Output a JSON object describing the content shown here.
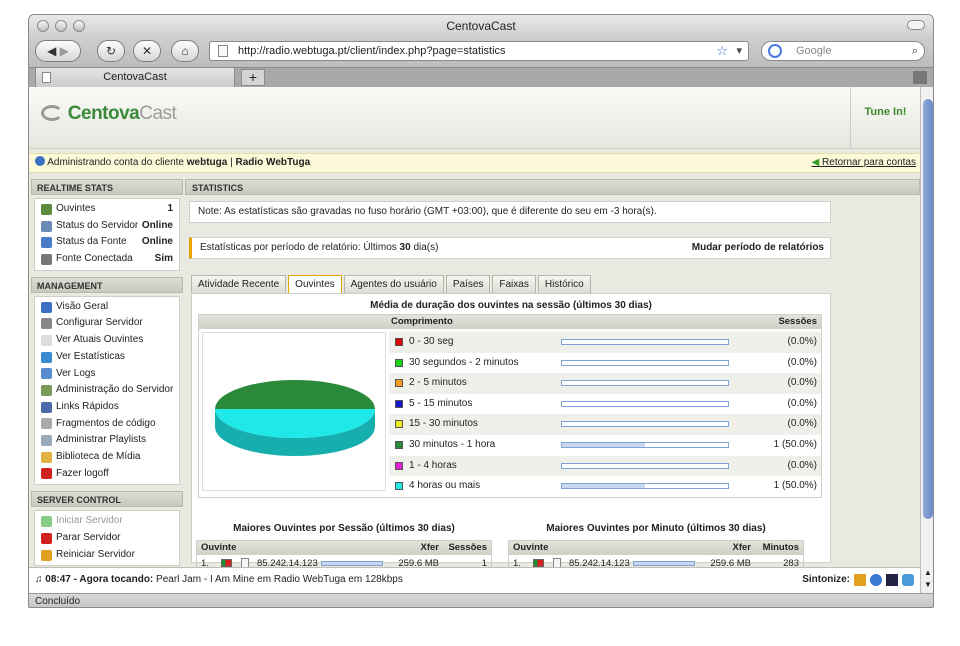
{
  "window": {
    "title": "CentovaCast"
  },
  "browser": {
    "url": "http://radio.webtuga.pt/client/index.php?page=statistics",
    "search_placeholder": "Google",
    "tab_title": "CentovaCast",
    "status": "Concluído"
  },
  "header": {
    "logo_main": "Centova",
    "logo_sub": "Cast",
    "tunein": "Tune In!"
  },
  "infobar": {
    "prefix": "Administrando conta do cliente",
    "client": "webtuga",
    "separator": "|",
    "station": "Radio WebTuga",
    "return_link": "Retornar para contas"
  },
  "sidebar": {
    "realtime": {
      "title": "REALTIME STATS",
      "items": [
        {
          "label": "Ouvintes",
          "value": "1",
          "icon": "listeners-icon"
        },
        {
          "label": "Status do Servidor",
          "value": "Online",
          "icon": "server-status-icon"
        },
        {
          "label": "Status da Fonte",
          "value": "Online",
          "icon": "source-status-icon"
        },
        {
          "label": "Fonte Conectada",
          "value": "Sim",
          "icon": "speaker-icon"
        }
      ]
    },
    "management": {
      "title": "MANAGEMENT",
      "items": [
        {
          "label": "Visão Geral",
          "icon": "info-icon"
        },
        {
          "label": "Configurar Servidor",
          "icon": "gear-icon"
        },
        {
          "label": "Ver Atuais Ouvintes",
          "icon": "document-icon"
        },
        {
          "label": "Ver Estatísticas",
          "icon": "globe-icon"
        },
        {
          "label": "Ver Logs",
          "icon": "magnifier-icon"
        },
        {
          "label": "Administração do Servidor",
          "icon": "server-admin-icon"
        },
        {
          "label": "Links Rápidos",
          "icon": "book-icon"
        },
        {
          "label": "Fragmentos de código",
          "icon": "code-icon"
        },
        {
          "label": "Administrar Playlists",
          "icon": "cd-icon"
        },
        {
          "label": "Biblioteca de Mídia",
          "icon": "folder-icon"
        },
        {
          "label": "Fazer logoff",
          "icon": "x-icon"
        }
      ]
    },
    "server_control": {
      "title": "SERVER CONTROL",
      "items": [
        {
          "label": "Iniciar Servidor",
          "icon": "start-icon",
          "disabled": true
        },
        {
          "label": "Parar Servidor",
          "icon": "stop-icon"
        },
        {
          "label": "Reiniciar Servidor",
          "icon": "restart-icon"
        }
      ]
    }
  },
  "main": {
    "title": "STATISTICS",
    "note": "Note: As estatísticas são gravadas no fuso horário (GMT +03:00), que é diferente do seu em -3 hora(s).",
    "period_prefix": "Estatísticas por período de relatório: Últimos",
    "period_days": "30",
    "period_suffix": "dia(s)",
    "period_change": "Mudar período de relatórios",
    "tabs": [
      "Atividade Recente",
      "Ouvintes",
      "Agentes do usuário",
      "Países",
      "Faixas",
      "Histórico"
    ],
    "active_tab": 1,
    "duration": {
      "title": "Média de duração dos ouvintes na sessão (últimos 30 dias)",
      "col_length": "Comprimento",
      "col_sessions": "Sessões",
      "rows": [
        {
          "label": "0 - 30 seg",
          "value": "(0.0%)",
          "color": "#e00000",
          "fraction": 0.0
        },
        {
          "label": "30 segundos - 2 minutos",
          "value": "(0.0%)",
          "color": "#19d619",
          "fraction": 0.0
        },
        {
          "label": "2 - 5 minutos",
          "value": "(0.0%)",
          "color": "#f59a1f",
          "fraction": 0.0
        },
        {
          "label": "5 - 15 minutos",
          "value": "(0.0%)",
          "color": "#1414c8",
          "fraction": 0.0
        },
        {
          "label": "15 - 30 minutos",
          "value": "(0.0%)",
          "color": "#ecec1c",
          "fraction": 0.0
        },
        {
          "label": "30 minutos - 1 hora",
          "value": "1 (50.0%)",
          "color": "#2a8a3a",
          "fraction": 0.5
        },
        {
          "label": "1 - 4 horas",
          "value": "(0.0%)",
          "color": "#e21ed6",
          "fraction": 0.0
        },
        {
          "label": "4 horas ou mais",
          "value": "1 (50.0%)",
          "color": "#1ee8e8",
          "fraction": 0.5
        }
      ]
    },
    "top_session": {
      "title": "Maiores Ouvintes por Sessão (últimos 30 dias)",
      "col_listener": "Ouvinte",
      "col_xfer": "Xfer",
      "col_last": "Sessões",
      "rows": [
        {
          "index": "1.",
          "ip": "85.242.14.123",
          "xfer": "259.6 MB",
          "last": "1"
        }
      ]
    },
    "top_minutes": {
      "title": "Maiores Ouvintes por Minuto (últimos 30 dias)",
      "col_listener": "Ouvinte",
      "col_xfer": "Xfer",
      "col_last": "Minutos",
      "rows": [
        {
          "index": "1.",
          "ip": "85.242.14.123",
          "xfer": "259.6 MB",
          "last": "283"
        }
      ]
    }
  },
  "nowplaying": {
    "time": "08:47",
    "label": "- Agora tocando:",
    "track": "Pearl Jam - I Am Mine em Radio WebTuga em 128kbps",
    "tune_label": "Sintonize:"
  }
}
